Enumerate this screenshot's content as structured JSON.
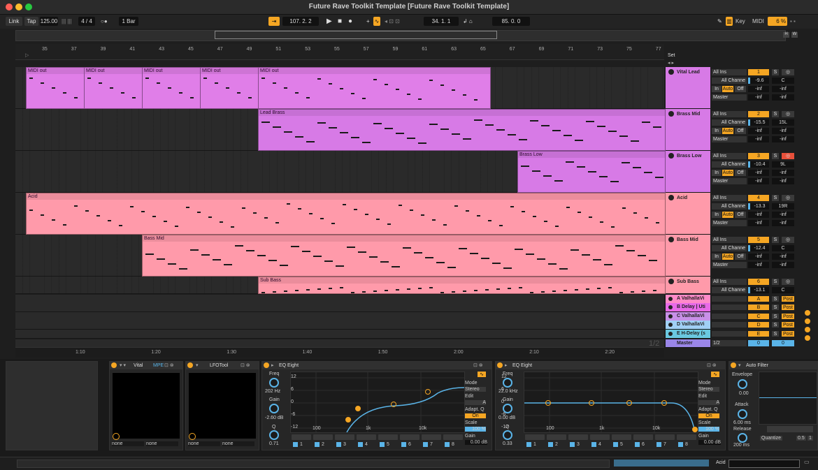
{
  "window": {
    "title": "Future Rave Toolkit Template  [Future Rave Toolkit Template]"
  },
  "transport": {
    "link": "Link",
    "tap": "Tap",
    "tempo": "125.00",
    "meter": "4 / 4",
    "quantize": "1 Bar",
    "position": "107.  2.  2",
    "loop_start": "34.  1.  1",
    "loop_length": "85.  0.  0",
    "key": "Key",
    "midi": "MIDI",
    "cpu": "6 %"
  },
  "ruler": {
    "bars": [
      "35",
      "37",
      "39",
      "41",
      "43",
      "45",
      "47",
      "49",
      "51",
      "53",
      "55",
      "57",
      "59",
      "61",
      "63",
      "65",
      "67",
      "69",
      "71",
      "73",
      "75",
      "77"
    ],
    "set": "Set"
  },
  "time_ruler": {
    "marks": [
      "1:10",
      "1:20",
      "1:30",
      "1:40",
      "1:50",
      "2:00",
      "2:10",
      "2:20"
    ],
    "page": "1/2"
  },
  "tracks": [
    {
      "name": "Vital Lead",
      "number": "1",
      "input": "All Ins",
      "channel": "All Channe",
      "volume": "-9.6",
      "pan": "C",
      "send_a": "-inf",
      "send_b": "-inf",
      "send_c": "-inf",
      "send_d": "-inf",
      "route": "Master",
      "clips": [
        "MIDI out",
        "MIDI out",
        "MIDI out",
        "MIDI out",
        "MIDI out"
      ]
    },
    {
      "name": "Brass Mid",
      "number": "2",
      "input": "All Ins",
      "channel": "All Channe",
      "volume": "-15.5",
      "pan": "15L",
      "send_a": "-inf",
      "send_b": "-inf",
      "send_c": "-inf",
      "send_d": "-inf",
      "route": "Master",
      "clips": [
        "Lead Brass"
      ]
    },
    {
      "name": "Brass Low",
      "number": "3",
      "input": "All Ins",
      "channel": "All Channe",
      "volume": "-10.4",
      "pan": "9L",
      "send_a": "-inf",
      "send_b": "-inf",
      "send_c": "-inf",
      "send_d": "-inf",
      "route": "Master",
      "clips": [
        "Brass Low"
      ]
    },
    {
      "name": "Acid",
      "number": "4",
      "input": "All Ins",
      "channel": "All Channe",
      "volume": "-13.3",
      "pan": "19R",
      "send_a": "-inf",
      "send_b": "-inf",
      "send_c": "-inf",
      "send_d": "-inf",
      "route": "Master",
      "clips": [
        "Acid"
      ]
    },
    {
      "name": "Bass Mid",
      "number": "5",
      "input": "All Ins",
      "channel": "All Channe",
      "volume": "-12.4",
      "pan": "C",
      "send_a": "-inf",
      "send_b": "-inf",
      "send_c": "-inf",
      "send_d": "-inf",
      "route": "Master",
      "clips": [
        "Bass Mid"
      ]
    },
    {
      "name": "Sub Bass",
      "number": "6",
      "input": "All Ins",
      "channel": "All Channe",
      "volume": "-13.1",
      "pan": "C",
      "clips": [
        "Sub Bass"
      ]
    }
  ],
  "monitor": {
    "in": "In",
    "auto": "Auto",
    "off": "Off",
    "solo": "S",
    "post": "Post"
  },
  "returns": [
    {
      "name": "A ValhallaVi",
      "letter": "A"
    },
    {
      "name": "B Delay | Uti",
      "letter": "B"
    },
    {
      "name": "C ValhallaVi",
      "letter": "C"
    },
    {
      "name": "D ValhallaVi",
      "letter": "D"
    },
    {
      "name": "E H-Delay (s",
      "letter": "E"
    }
  ],
  "master": {
    "name": "Master",
    "route": "1/2",
    "volume": "0",
    "pan": "0"
  },
  "devices": {
    "vital": {
      "title": "Vital",
      "mpe": "MPE",
      "macro1": "none",
      "macro2": "none"
    },
    "lfotool": {
      "title": "LFOTool",
      "macro1": "none",
      "macro2": "none"
    },
    "eq1": {
      "title": "EQ Eight",
      "freq_label": "Freq",
      "freq": "202 Hz",
      "gain_label": "Gain",
      "gain": "-2.60 dB",
      "q_label": "Q",
      "q": "0.71",
      "mode_label": "Mode",
      "mode": "Stereo",
      "edit_label": "Edit",
      "edit": "A",
      "adaptq_label": "Adapt. Q",
      "adaptq": "On",
      "scale_label": "Scale",
      "scale": "100 %",
      "outgain_label": "Gain",
      "outgain": "0.00 dB",
      "db_ticks": [
        "12",
        "6",
        "0",
        "-6",
        "-12"
      ],
      "freq_ticks": [
        "100",
        "1k",
        "10k"
      ],
      "bands": [
        "1",
        "2",
        "3",
        "4",
        "5",
        "6",
        "7",
        "8"
      ]
    },
    "eq2": {
      "title": "EQ Eight",
      "freq_label": "Freq",
      "freq": "22.0 kHz",
      "gain_label": "Gain",
      "gain": "0.00 dB",
      "q_label": "Q",
      "q": "0.33",
      "mode_label": "Mode",
      "mode": "Stereo",
      "edit_label": "Edit",
      "edit": "A",
      "adaptq_label": "Adapt. Q",
      "adaptq": "On",
      "scale_label": "Scale",
      "scale": "100 %",
      "outgain_label": "Gain",
      "outgain": "0.00 dB",
      "db_ticks": [
        "12",
        "6",
        "0",
        "-6",
        "-12"
      ],
      "freq_ticks": [
        "100",
        "1k",
        "10k"
      ],
      "bands": [
        "1",
        "2",
        "3",
        "4",
        "5",
        "6",
        "7",
        "8"
      ]
    },
    "autofilter": {
      "title": "Auto Filter",
      "envelope": "Envelope",
      "env_value": "0.00",
      "attack": "Attack",
      "attack_value": "6.00 ms",
      "release": "Release",
      "release_value": "200 ms",
      "quantize": "Quantize",
      "q1": "0.5",
      "q2": "1"
    }
  },
  "status": {
    "track": "Acid"
  }
}
